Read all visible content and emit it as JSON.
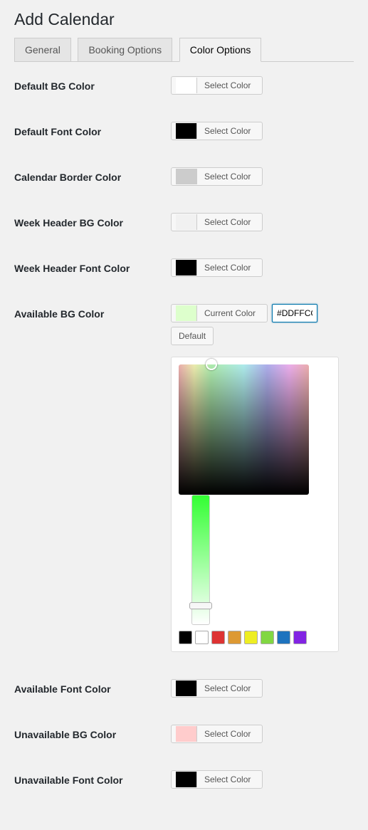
{
  "page": {
    "title": "Add Calendar"
  },
  "tabs": [
    {
      "label": "General",
      "active": false
    },
    {
      "label": "Booking Options",
      "active": false
    },
    {
      "label": "Color Options",
      "active": true
    }
  ],
  "rows": {
    "default_bg": {
      "label": "Default BG Color",
      "button_label": "Select Color",
      "swatch": "#ffffff"
    },
    "default_font": {
      "label": "Default Font Color",
      "button_label": "Select Color",
      "swatch": "#000000"
    },
    "border": {
      "label": "Calendar Border Color",
      "button_label": "Select Color",
      "swatch": "#cccccc"
    },
    "week_bg": {
      "label": "Week Header BG Color",
      "button_label": "Select Color",
      "swatch": "#f1f1f1"
    },
    "week_font": {
      "label": "Week Header Font Color",
      "button_label": "Select Color",
      "swatch": "#000000"
    },
    "available_bg": {
      "label": "Available BG Color",
      "button_label": "Current Color",
      "swatch": "#ddffcc"
    },
    "available_font": {
      "label": "Available Font Color",
      "button_label": "Select Color",
      "swatch": "#000000"
    },
    "unavailable_bg": {
      "label": "Unavailable BG Color",
      "button_label": "Select Color",
      "swatch": "#ffcccc"
    },
    "unavailable_font": {
      "label": "Unavailable Font Color",
      "button_label": "Select Color",
      "swatch": "#000000"
    }
  },
  "picker": {
    "hex_value": "#DDFFCC",
    "default_label": "Default",
    "palette": [
      "#000000",
      "#ffffff",
      "#dd3333",
      "#dd9933",
      "#eeee22",
      "#81d742",
      "#1e73be",
      "#8224e3"
    ]
  }
}
